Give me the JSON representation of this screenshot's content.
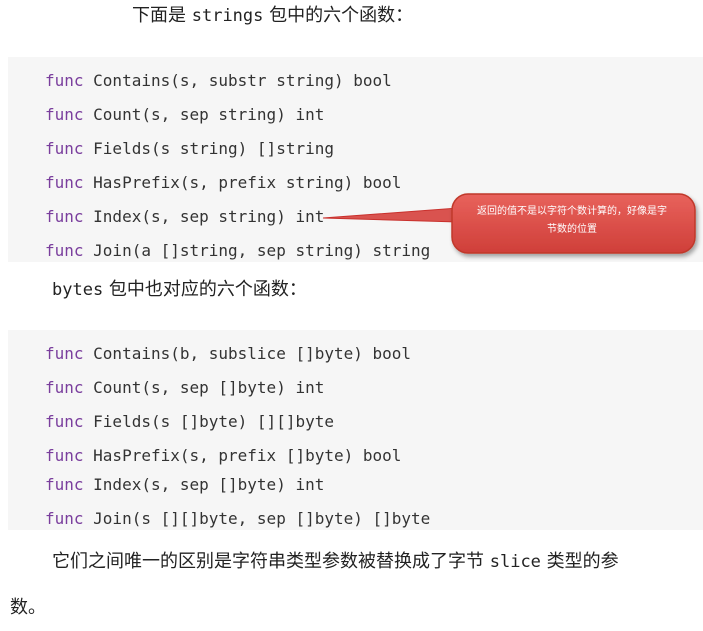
{
  "intro1": {
    "before": "下面是 ",
    "code": "strings",
    "after": " 包中的六个函数："
  },
  "block1": [
    {
      "kw": "func",
      "sig": " Contains(s, substr string) bool"
    },
    {
      "kw": "func",
      "sig": " Count(s, sep string) int"
    },
    {
      "kw": "func",
      "sig": " Fields(s string) []string"
    },
    {
      "kw": "func",
      "sig": " HasPrefix(s, prefix string) bool"
    },
    {
      "kw": "func",
      "sig": " Index(s, sep string) int"
    },
    {
      "kw": "func",
      "sig": " Join(a []string, sep string) string"
    }
  ],
  "intro2": {
    "code": "bytes",
    "after": " 包中也对应的六个函数："
  },
  "block2": [
    {
      "kw": "func",
      "sig": " Contains(b, subslice []byte) bool"
    },
    {
      "kw": "func",
      "sig": " Count(s, sep []byte) int"
    },
    {
      "kw": "func",
      "sig": " Fields(s []byte) [][]byte"
    },
    {
      "kw": "func",
      "sig": " HasPrefix(s, prefix []byte) bool"
    },
    {
      "kw": "func",
      "sig": " Index(s, sep []byte) int"
    },
    {
      "kw": "func",
      "sig": " Join(s [][]byte, sep []byte) []byte"
    }
  ],
  "closing": {
    "before": "它们之间唯一的区别是字符串类型参数被替换成了字节 ",
    "code": "slice",
    "after": " 类型的参",
    "line2": "数。"
  },
  "callout": {
    "line1": "返回的值不是以字符个数计算的，好像是字",
    "line2": "节数的位置",
    "fill_color": "#d9534f",
    "border_color": "#c9302c"
  },
  "colors": {
    "keyword": "#7a3e9d",
    "code_bg": "#f6f6f6",
    "text": "#222222"
  }
}
